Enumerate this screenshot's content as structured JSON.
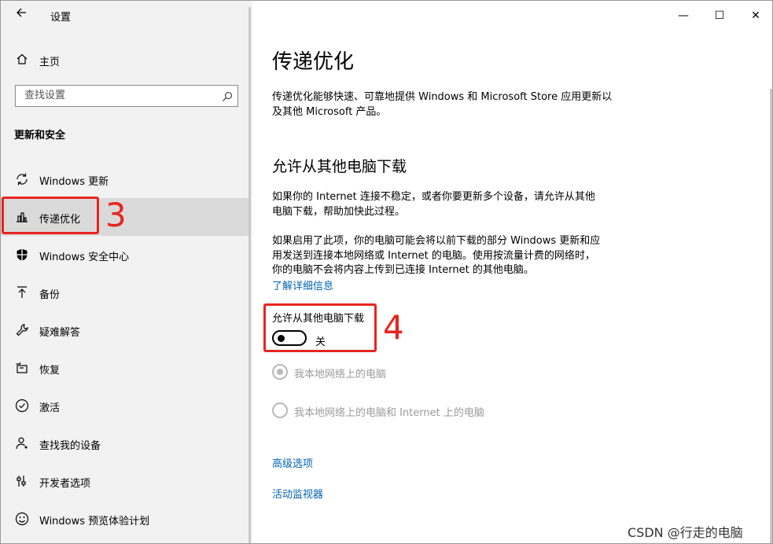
{
  "window": {
    "title": "设置",
    "controls": {
      "minimize": "—",
      "maximize": "☐",
      "close": "✕"
    }
  },
  "sidebar": {
    "home_label": "主页",
    "search_placeholder": "查找设置",
    "section_heading": "更新和安全",
    "items": [
      {
        "label": "Windows 更新",
        "icon": "refresh-icon"
      },
      {
        "label": "传递优化",
        "icon": "delivery-optimization-icon",
        "selected": true
      },
      {
        "label": "Windows 安全中心",
        "icon": "shield-icon"
      },
      {
        "label": "备份",
        "icon": "backup-arrow-icon"
      },
      {
        "label": "疑难解答",
        "icon": "wrench-icon"
      },
      {
        "label": "恢复",
        "icon": "recovery-icon"
      },
      {
        "label": "激活",
        "icon": "check-circle-icon"
      },
      {
        "label": "查找我的设备",
        "icon": "person-location-icon"
      },
      {
        "label": "开发者选项",
        "icon": "developer-sliders-icon"
      },
      {
        "label": "Windows 预览体验计划",
        "icon": "smiley-icon"
      }
    ]
  },
  "content": {
    "title": "传递优化",
    "intro_line1": "传递优化能够快速、可靠地提供 Windows 和 Microsoft Store 应用更新以",
    "intro_line2": "及其他 Microsoft 产品。",
    "section_title": "允许从其他电脑下载",
    "para1_line1": "如果你的 Internet 连接不稳定，或者你要更新多个设备，请允许从其他",
    "para1_line2": "电脑下载，帮助加快此过程。",
    "para2_line1": "如果启用了此项，你的电脑可能会将以前下载的部分 Windows 更新和应",
    "para2_line2": "用发送到连接本地网络或 Internet 的电脑。使用按流量计费的网络时，",
    "para2_line3": "你的电脑不会将内容上传到已连接 Internet 的其他电脑。",
    "learn_more": "了解详细信息",
    "toggle_label": "允许从其他电脑下载",
    "toggle_state": "关",
    "toggle_on": false,
    "radio_options": [
      {
        "label": "我本地网络上的电脑",
        "selected": true,
        "disabled": true
      },
      {
        "label": "我本地网络上的电脑和 Internet 上的电脑",
        "selected": false,
        "disabled": true
      }
    ],
    "advanced_link": "高级选项",
    "activity_link": "活动监视器"
  },
  "annotations": {
    "step3": "3",
    "step4": "4",
    "color": "#e8251e"
  },
  "watermark": "CSDN @行走的电脑",
  "colors": {
    "accent_link": "#0063b1",
    "sidebar_bg": "#f2f2f2",
    "selected_bg": "#dadada"
  }
}
